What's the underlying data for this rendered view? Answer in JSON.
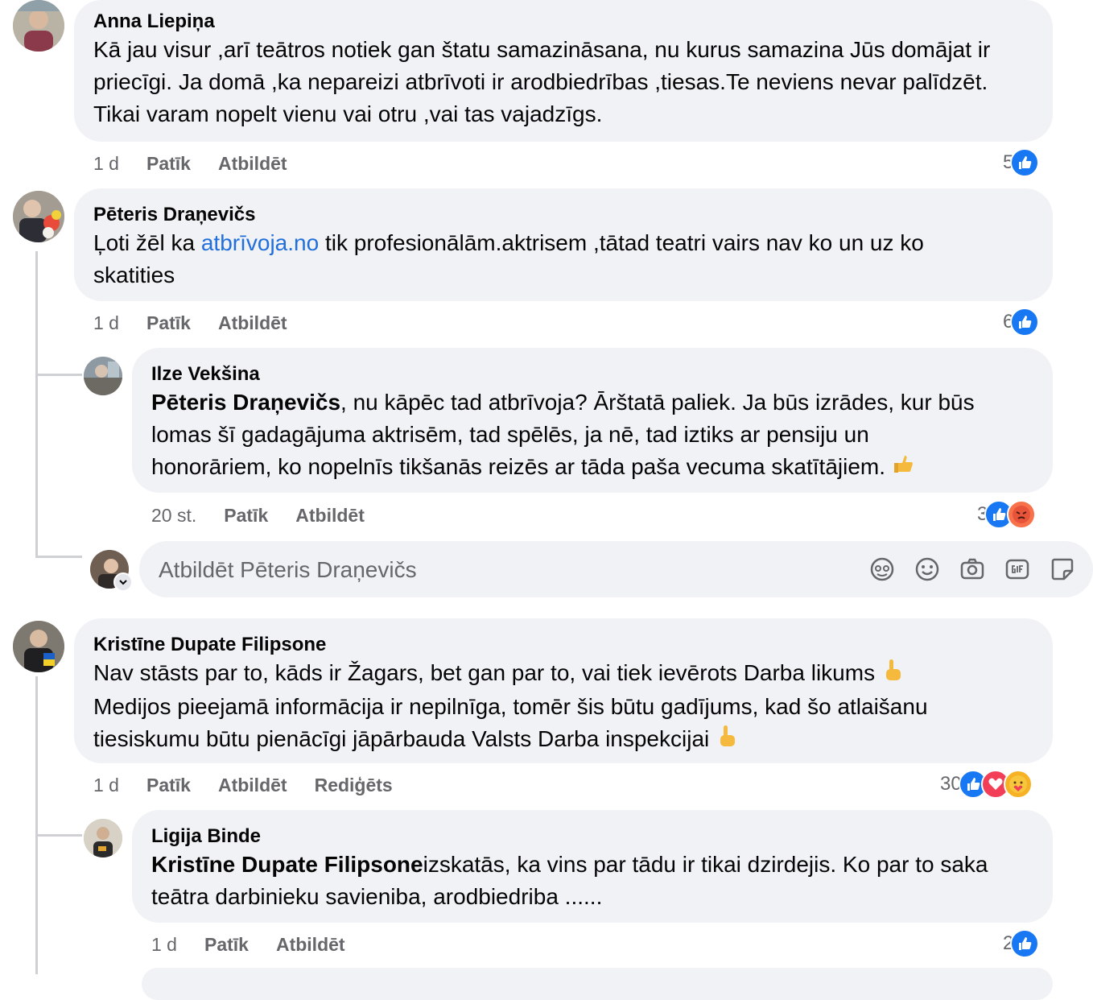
{
  "comments": [
    {
      "author": "Anna Liepiņa",
      "lines": [
        "Kā jau visur ,arī teātros notiek gan štatu samazināsana, nu kurus samazina Jūs domājat ir",
        "priecīgi. Ja domā ,ka nepareizi atbrīvoti ir arodbiedrības ,tiesas.Te neviens nevar palīdzēt.",
        "Tikai varam nopelt vienu vai otru ,vai tas vajadzīgs."
      ],
      "time": "1 d",
      "like": "Patīk",
      "reply": "Atbildēt",
      "reaction_count": "5",
      "reactions": [
        "like-icon"
      ]
    },
    {
      "author": "Pēteris Draņevičs",
      "line1_before": "Ļoti žēl ka ",
      "line1_link": "atbrīvoja.no",
      "line1_after": " tik profesionālām.aktrisem ,tātad teatri vairs nav ko un uz ko",
      "line2": "skatities",
      "time": "1 d",
      "like": "Patīk",
      "reply": "Atbildēt",
      "reaction_count": "6",
      "reactions": [
        "like-icon"
      ]
    },
    {
      "author": "Ilze Vekšina",
      "mention": "Pēteris Draņevičs",
      "line1_after": ", nu kāpēc tad atbrīvoja? Ārštatā paliek. Ja būs izrādes, kur būs",
      "line2": "lomas šī gadagājuma aktrisēm, tad spēlēs, ja nē, tad iztiks ar pensiju un",
      "line3": "honorāriem, ko nopelnīs tikšanās reizēs ar tāda paša vecuma skatītājiem.",
      "time": "20 st.",
      "like": "Patīk",
      "reply": "Atbildēt",
      "reaction_count": "3",
      "reactions": [
        "like-icon",
        "angry-icon"
      ]
    },
    {
      "author": "Kristīne Dupate Filipsone",
      "line1": "Nav stāsts par to, kāds ir Žagars, bet gan par to, vai tiek ievērots Darba likums",
      "line2": "Medijos pieejamā informācija ir nepilnīga, tomēr šis būtu gadījums, kad šo atlaišanu",
      "line3": "tiesiskumu būtu pienācīgi jāpārbauda Valsts Darba inspekcijai",
      "time": "1 d",
      "like": "Patīk",
      "reply": "Atbildēt",
      "edited": "Rediģēts",
      "reaction_count": "30",
      "reactions": [
        "like-icon",
        "love-icon",
        "care-icon"
      ]
    },
    {
      "author": "Ligija Binde",
      "mention": "Kristīne Dupate Filipsone",
      "line1_after": "izskatās, ka vins par tādu ir tikai dzirdejis. Ko par to saka",
      "line2": "teātra darbinieku savieniba, arodbiedriba ......",
      "time": "1 d",
      "like": "Patīk",
      "reply": "Atbildēt",
      "reaction_count": "2",
      "reactions": [
        "like-icon"
      ]
    }
  ],
  "composer": {
    "placeholder": "Atbildēt Pēteris Draņevičs",
    "icons": [
      "avatar-sticker-icon",
      "emoji-icon",
      "camera-icon",
      "gif-icon",
      "sticker-icon"
    ]
  },
  "colors": {
    "bubble": "#f0f2f5",
    "link": "#216fdb",
    "like": "#1877f2",
    "meta": "#65676b"
  }
}
